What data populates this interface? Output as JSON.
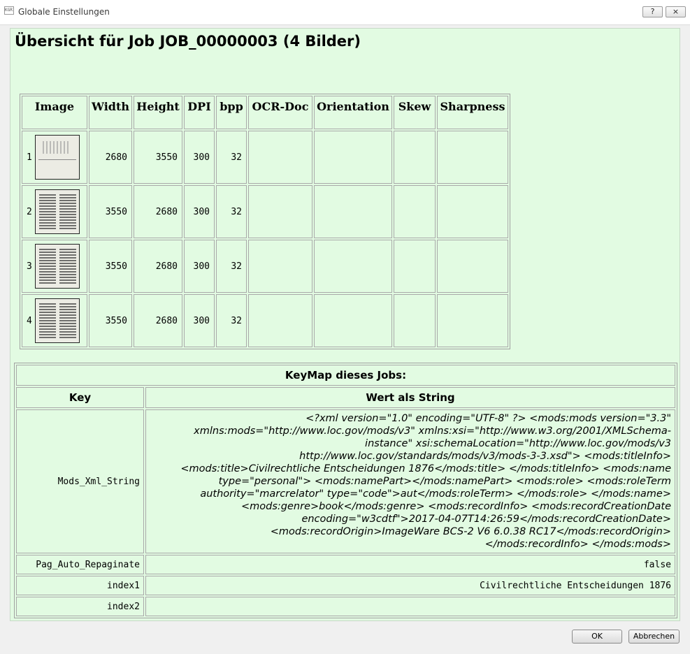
{
  "window": {
    "icon_text": "KGRI",
    "title": "Globale Einstellungen",
    "help_label": "?",
    "close_label": "×"
  },
  "heading": "Übersicht für Job JOB_00000003 (4 Bilder)",
  "images_table": {
    "headers": {
      "image": "Image",
      "width": "Width",
      "height": "Height",
      "dpi": "DPI",
      "bpp": "bpp",
      "ocr_doc": "OCR-Doc",
      "orientation": "Orientation",
      "skew": "Skew",
      "sharpness": "Sharpness"
    },
    "rows": [
      {
        "index": "1",
        "width": "2680",
        "height": "3550",
        "dpi": "300",
        "bpp": "32",
        "ocr_doc": "",
        "orientation": "",
        "skew": "",
        "sharpness": ""
      },
      {
        "index": "2",
        "width": "3550",
        "height": "2680",
        "dpi": "300",
        "bpp": "32",
        "ocr_doc": "",
        "orientation": "",
        "skew": "",
        "sharpness": ""
      },
      {
        "index": "3",
        "width": "3550",
        "height": "2680",
        "dpi": "300",
        "bpp": "32",
        "ocr_doc": "",
        "orientation": "",
        "skew": "",
        "sharpness": ""
      },
      {
        "index": "4",
        "width": "3550",
        "height": "2680",
        "dpi": "300",
        "bpp": "32",
        "ocr_doc": "",
        "orientation": "",
        "skew": "",
        "sharpness": ""
      }
    ]
  },
  "keymap": {
    "title": "KeyMap dieses Jobs:",
    "col_key": "Key",
    "col_value": "Wert als String",
    "rows": [
      {
        "key": "Mods_Xml_String",
        "value": "<?xml version=\"1.0\" encoding=\"UTF-8\" ?> <mods:mods version=\"3.3\" xmlns:mods=\"http://www.loc.gov/mods/v3\" xmlns:xsi=\"http://www.w3.org/2001/XMLSchema-instance\" xsi:schemaLocation=\"http://www.loc.gov/mods/v3 http://www.loc.gov/standards/mods/v3/mods-3-3.xsd\"> <mods:titleInfo> <mods:title>Civilrechtliche Entscheidungen 1876</mods:title> </mods:titleInfo> <mods:name type=\"personal\"> <mods:namePart></mods:namePart> <mods:role> <mods:roleTerm authority=\"marcrelator\" type=\"code\">aut</mods:roleTerm> </mods:role> </mods:name> <mods:genre>book</mods:genre> <mods:recordInfo> <mods:recordCreationDate encoding=\"w3cdtf\">2017-04-07T14:26:59</mods:recordCreationDate> <mods:recordOrigin>ImageWare BCS-2 V6 6.0.38 RC17</mods:recordOrigin> </mods:recordInfo> </mods:mods>"
      },
      {
        "key": "Pag_Auto_Repaginate",
        "value": "false"
      },
      {
        "key": "index1",
        "value": "Civilrechtliche Entscheidungen 1876"
      },
      {
        "key": "index2",
        "value": ""
      }
    ]
  },
  "buttons": {
    "ok": "OK",
    "cancel": "Abbrechen"
  }
}
